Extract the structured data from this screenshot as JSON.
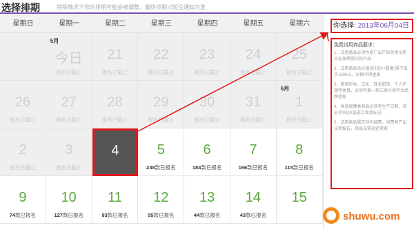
{
  "header": {
    "title": "选择排期",
    "hint": "特殊情况下您的排期可能会被调整，最终排期以短信通知为准"
  },
  "weekdays": [
    "星期日",
    "星期一",
    "星期二",
    "星期三",
    "星期四",
    "星期五",
    "星期六"
  ],
  "weeks": [
    [
      {
        "day": "",
        "status": ""
      },
      {
        "day": "今日",
        "status": "报名已截止",
        "month": "5月"
      },
      {
        "day": "21",
        "status": "报名已截止"
      },
      {
        "day": "22",
        "status": "报名已截止"
      },
      {
        "day": "23",
        "status": "报名已截止"
      },
      {
        "day": "24",
        "status": "报名已截止"
      },
      {
        "day": "25",
        "status": "报名已截止"
      }
    ],
    [
      {
        "day": "26",
        "status": "报名已截止"
      },
      {
        "day": "27",
        "status": "报名已截止"
      },
      {
        "day": "28",
        "status": "报名已截止"
      },
      {
        "day": "29",
        "status": "报名已截止"
      },
      {
        "day": "30",
        "status": "报名已截止"
      },
      {
        "day": "31",
        "status": "报名已截止"
      },
      {
        "day": "1",
        "status": "报名已截止",
        "month": "6月"
      }
    ],
    [
      {
        "day": "2",
        "status": "报名已截止"
      },
      {
        "day": "3",
        "status": "报名已截止"
      },
      {
        "day": "4",
        "status": "",
        "selected": true
      },
      {
        "day": "5",
        "count": "238",
        "suffix": "款已报名"
      },
      {
        "day": "6",
        "count": "184",
        "suffix": "款已报名"
      },
      {
        "day": "7",
        "count": "166",
        "suffix": "款已报名"
      },
      {
        "day": "8",
        "count": "115",
        "suffix": "款已报名"
      }
    ],
    [
      {
        "day": "9",
        "count": "74",
        "suffix": "款已报名"
      },
      {
        "day": "10",
        "count": "127",
        "suffix": "款已报名"
      },
      {
        "day": "11",
        "count": "93",
        "suffix": "款已报名"
      },
      {
        "day": "12",
        "count": "55",
        "suffix": "款已报名"
      },
      {
        "day": "13",
        "count": "44",
        "suffix": "款已报名"
      },
      {
        "day": "14",
        "count": "43",
        "suffix": "款已报名"
      },
      {
        "day": "15",
        "count": "",
        "suffix": ""
      }
    ]
  ],
  "side": {
    "selected_label": "你选择:",
    "selected_date": "2013年06月04日",
    "rules_title": "免费试用商品要求：",
    "rules": [
      "1、试用商品必须为原厂出产的合格全新且在保质期内的产品",
      "2、试用商品总价值(折扣价×数量)需不低于1500元，价格不得虚高",
      "3、美容彩妆、日化、珠宝配饰、个人护理等类目，必须有第一期三家分销平台品牌授权",
      "4、食品保健类商品必须有生产日期，且必须有QS或进口食品标记",
      "5、试用商品需支持包邮费，消费者产出试用报告，商品无需返还卖家"
    ]
  },
  "watermark": "shuwu.com",
  "colors": {
    "accent": "#7a4eb3",
    "highlight_red": "#e0181b",
    "available_green": "#5aa83b",
    "selected_bg": "#555555"
  }
}
